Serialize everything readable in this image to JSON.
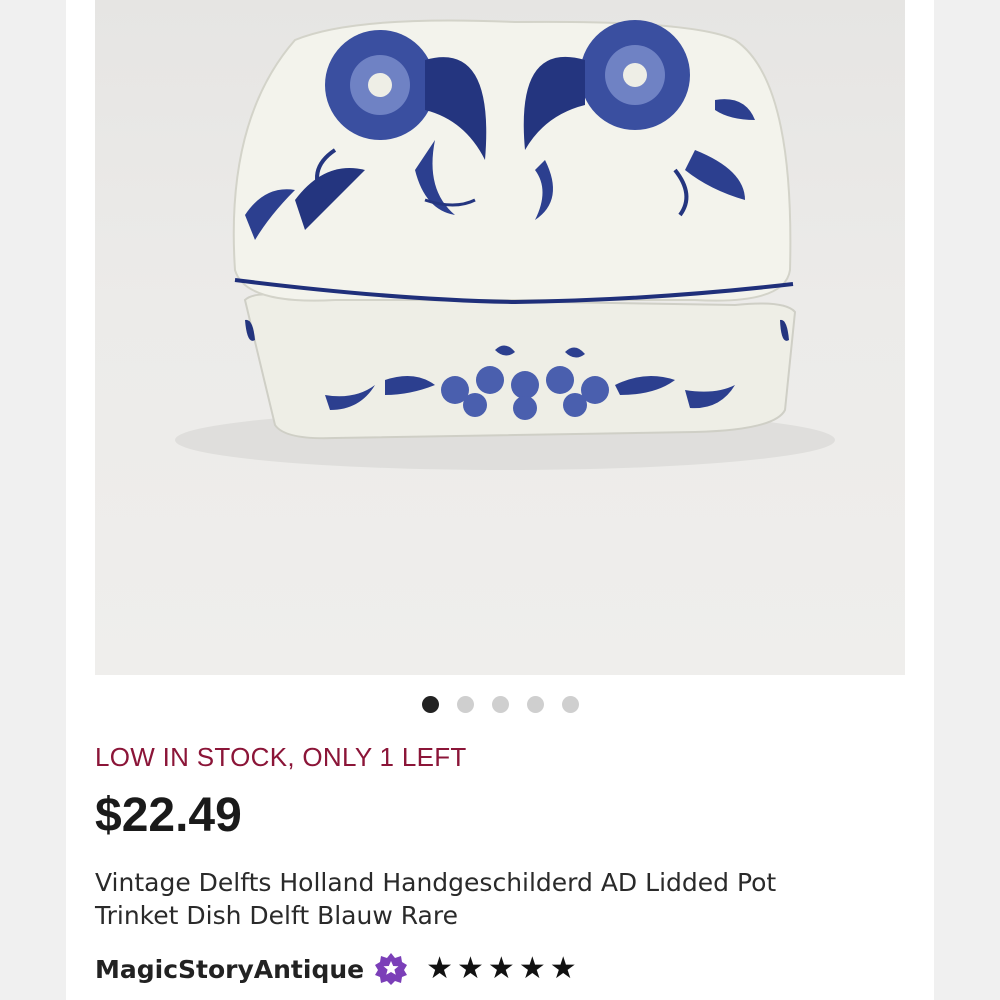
{
  "listing": {
    "stock_text": "LOW IN STOCK, ONLY 1 LEFT",
    "price": "$22.49",
    "title_line1": "Vintage Delfts Holland Handgeschilderd AD Lidded Pot",
    "title_line2": "Trinket Dish Delft Blauw Rare"
  },
  "carousel": {
    "total_images": 5,
    "active_index": 1
  },
  "seller": {
    "name": "MagicStoryAntique",
    "badge_icon": "star-seller-badge-icon",
    "rating_stars": 5
  },
  "colors": {
    "stock_text": "#8b1538",
    "badge": "#7b3fb8",
    "delft_blue": "#1f2f7a"
  }
}
